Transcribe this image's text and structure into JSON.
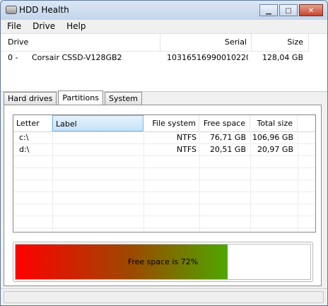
{
  "window": {
    "title": "HDD Health"
  },
  "menu": {
    "file": "File",
    "drive": "Drive",
    "help": "Help"
  },
  "drives": {
    "headers": {
      "drive": "Drive",
      "serial": "Serial",
      "size": "Size"
    },
    "rows": [
      {
        "index": "0 -",
        "name": "Corsair CSSD-V128GB2",
        "serial": "10316516990010220...",
        "size": "128,04 GB"
      }
    ]
  },
  "tabs": [
    "Hard drives",
    "Partitions",
    "System"
  ],
  "active_tab": "Partitions",
  "partitions": {
    "headers": {
      "letter": "Letter",
      "label": "Label",
      "fs": "File system",
      "free": "Free space",
      "total": "Total size"
    },
    "rows": [
      {
        "letter": "c:\\",
        "label": "",
        "fs": "NTFS",
        "free": "76,71 GB",
        "total": "106,96 GB"
      },
      {
        "letter": "d:\\",
        "label": "",
        "fs": "NTFS",
        "free": "20,51 GB",
        "total": "20,97 GB"
      }
    ]
  },
  "progress": {
    "text": "Free space is 72%",
    "fraction": 0.72
  },
  "colors": {
    "gradient_start": "#ff0000",
    "gradient_end": "#4ea700",
    "selected_header": "#c5e2f6"
  }
}
